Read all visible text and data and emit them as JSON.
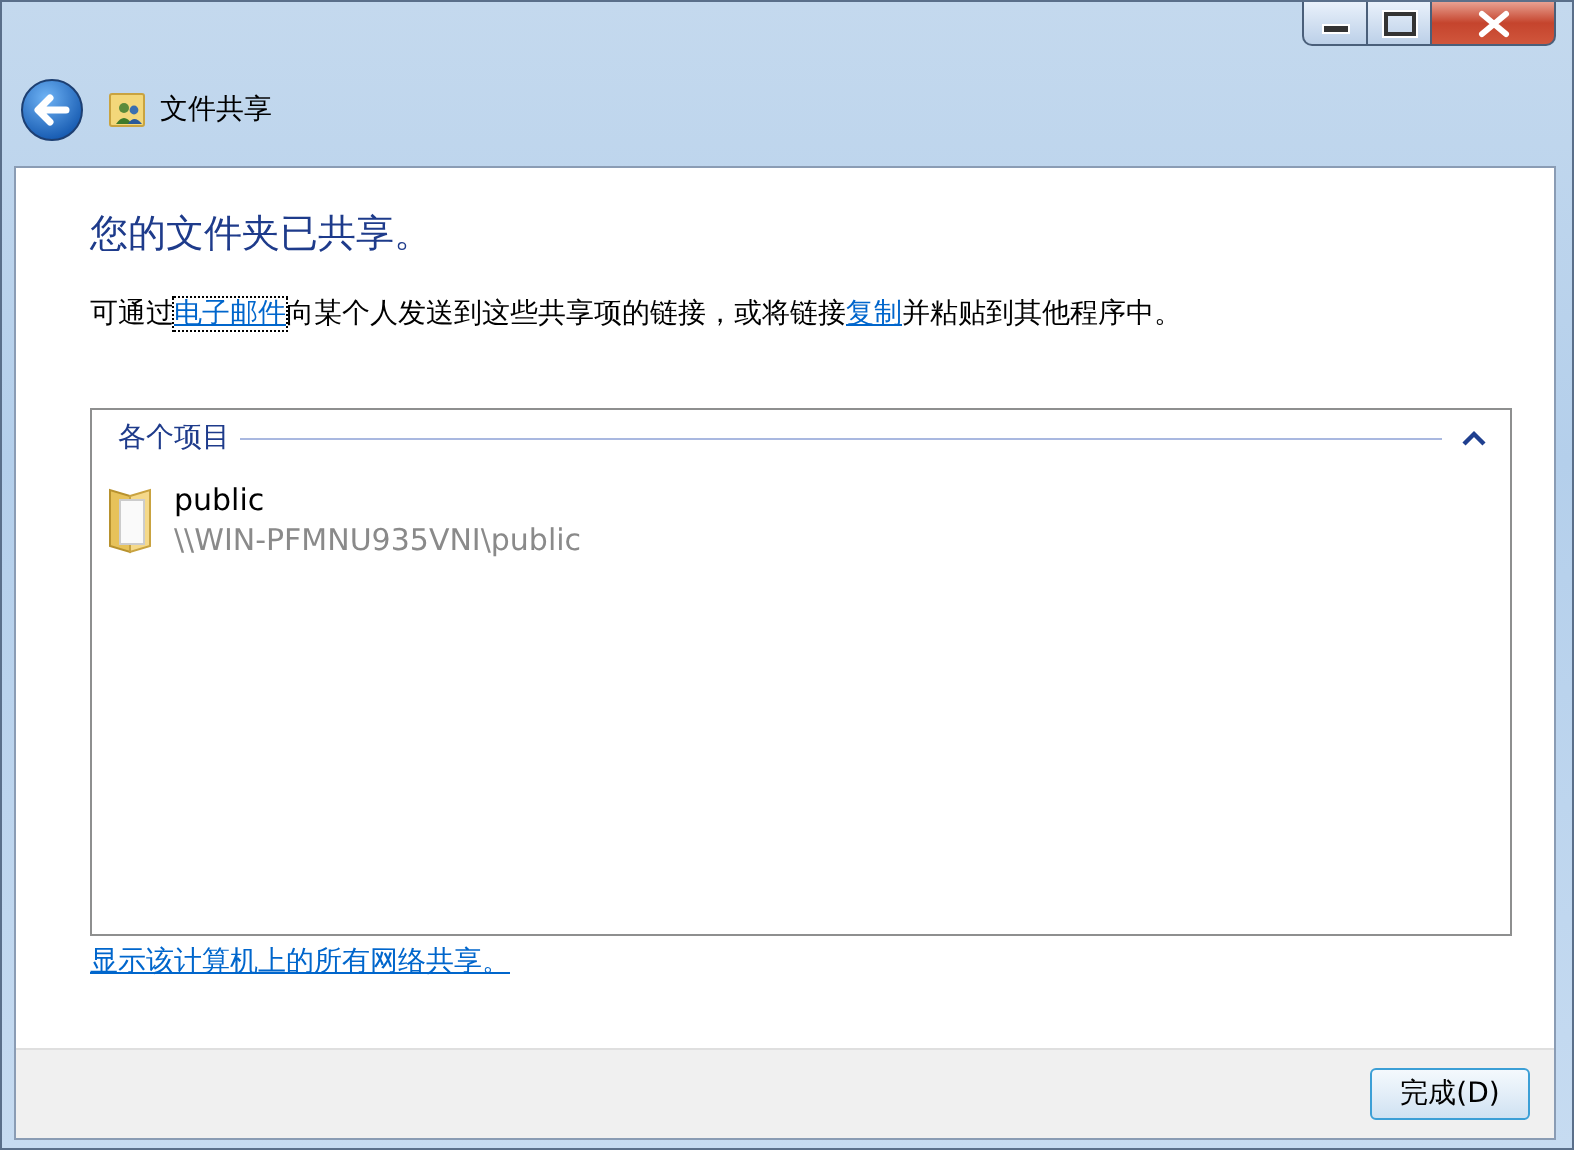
{
  "window": {
    "title": "文件共享"
  },
  "heading": "您的文件夹已共享。",
  "intro": [
    {
      "kind": "text",
      "text": "可通过"
    },
    {
      "kind": "link",
      "text": "电子邮件",
      "focused": true
    },
    {
      "kind": "text",
      "text": "向某个人发送到这些共享项的链接，或将链接"
    },
    {
      "kind": "link",
      "text": "复制",
      "focused": false
    },
    {
      "kind": "text",
      "text": "并粘贴到其他程序中。"
    }
  ],
  "group": {
    "title": "各个项目",
    "expanded": true,
    "items": [
      {
        "name": "public",
        "path": "\\\\WIN-PFMNU935VNI\\public"
      }
    ]
  },
  "show_all_link": "显示该计算机上的所有网络共享。",
  "buttons": [
    "完成(D)"
  ]
}
